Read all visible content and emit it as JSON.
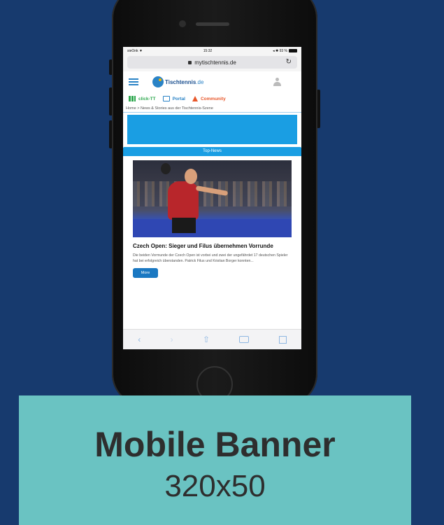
{
  "phone": {
    "status": {
      "carrier": "sieOnk ▼",
      "time": "15:32",
      "battery": "◂ ✱ 93 %"
    },
    "url_bar": {
      "domain": "mytischtennis.de",
      "reload_icon": "reload-icon"
    },
    "site_header": {
      "logo_text": "Tischtennis",
      "logo_suffix": ".de"
    },
    "nav_links": [
      {
        "label": "click-TT",
        "icon": "grid-icon",
        "color": "#2fa84f"
      },
      {
        "label": "Portal",
        "icon": "monitor-icon",
        "color": "#2a83c6"
      },
      {
        "label": "Community",
        "icon": "people-icon",
        "color": "#e8572a"
      }
    ],
    "breadcrumb": "Home  >  News & Stories aus der Tischtennis-Szene",
    "section_label": "Top-News",
    "article": {
      "headline": "Czech Open: Sieger und Filus übernehmen Vorrunde",
      "teaser": "Die beiden Vormunde der Czech Open ist vorbei und zwei der ungefährdet 17 deutschen Spieler hat bei erfolgreich überstanden. Patrick Filus und Kristian Borger konnten...",
      "button_label": "More"
    },
    "safari_toolbar": {
      "back": "‹",
      "forward": "›",
      "share": "⇧"
    }
  },
  "caption": {
    "title": "Mobile Banner",
    "size": "320x50"
  },
  "colors": {
    "background": "#173a6e",
    "caption_bg": "#6ac3c2",
    "ad_blue": "#1a9ee3"
  }
}
